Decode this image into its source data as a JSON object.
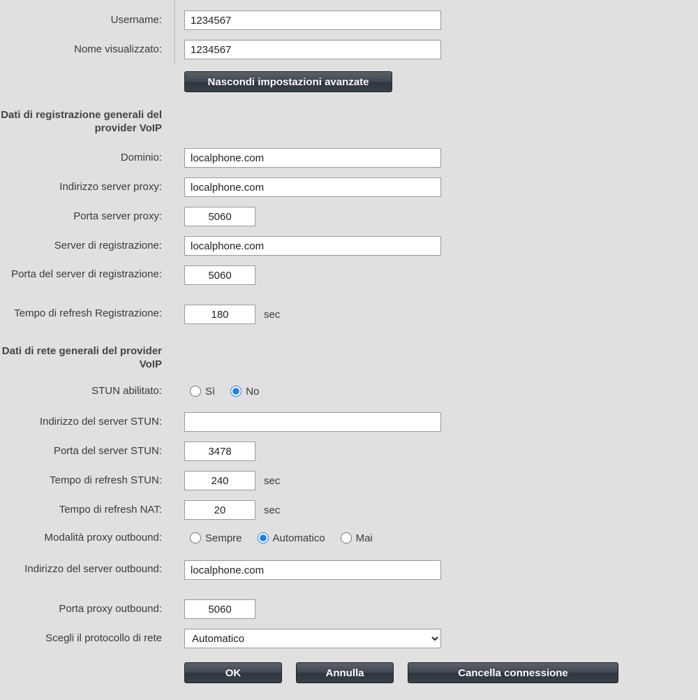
{
  "personal": {
    "username_label": "Username:",
    "username_value": "1234567",
    "displayname_label": "Nome visualizzato:",
    "displayname_value": "1234567"
  },
  "toggle_button": "Nascondi impostazioni avanzate",
  "reg_section_title": "Dati di registrazione generali del provider VoIP",
  "reg": {
    "domain_label": "Dominio:",
    "domain_value": "localphone.com",
    "proxy_addr_label": "Indirizzo server proxy:",
    "proxy_addr_value": "localphone.com",
    "proxy_port_label": "Porta server proxy:",
    "proxy_port_value": "5060",
    "reg_server_label": "Server di registrazione:",
    "reg_server_value": "localphone.com",
    "reg_port_label": "Porta del server di registrazione:",
    "reg_port_value": "5060",
    "reg_refresh_label": "Tempo di refresh Registrazione:",
    "reg_refresh_value": "180",
    "sec_suffix": "sec"
  },
  "net_section_title": "Dati di rete generali del provider VoIP",
  "net": {
    "stun_enabled_label": "STUN abilitato:",
    "stun_yes": "Sì",
    "stun_no": "No",
    "stun_selected": "no",
    "stun_addr_label": "Indirizzo del server STUN:",
    "stun_addr_value": "",
    "stun_port_label": "Porta del server STUN:",
    "stun_port_value": "3478",
    "stun_refresh_label": "Tempo di refresh STUN:",
    "stun_refresh_value": "240",
    "nat_refresh_label": "Tempo di refresh NAT:",
    "nat_refresh_value": "20",
    "outbound_mode_label": "Modalità proxy outbound:",
    "outbound_mode_always": "Sempre",
    "outbound_mode_auto": "Automatico",
    "outbound_mode_never": "Mai",
    "outbound_mode_selected": "auto",
    "outbound_addr_label": "Indirizzo del server outbound:",
    "outbound_addr_value": "localphone.com",
    "outbound_port_label": "Porta proxy outbound:",
    "outbound_port_value": "5060",
    "protocol_label": "Scegli il protocollo di rete",
    "protocol_value": "Automatico",
    "sec_suffix": "sec"
  },
  "buttons": {
    "ok": "OK",
    "cancel": "Annulla",
    "delete": "Cancella connessione"
  }
}
